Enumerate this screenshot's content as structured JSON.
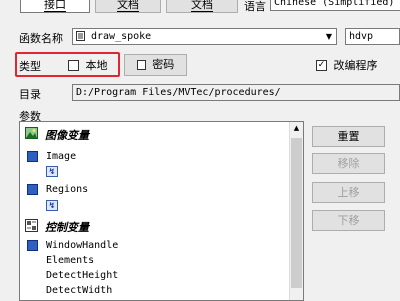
{
  "top_buttons": {
    "interface": "接口",
    "doc1": "文档",
    "doc2": "文档"
  },
  "language": {
    "label": "语言",
    "value": "Chinese (Simplified)"
  },
  "procedure": {
    "label": "函数名称",
    "name": "draw_spoke",
    "extension": "hdvp"
  },
  "type": {
    "label": "类型",
    "local_label": "本地",
    "local_checked": false
  },
  "password_button": "密码",
  "modify": {
    "label": "改编程序",
    "checked": true
  },
  "directory": {
    "label": "目录",
    "path": "D:/Program Files/MVTec/procedures/"
  },
  "params_label": "参数",
  "param_groups": {
    "iconic": {
      "title": "图像变量",
      "items": [
        "Image",
        "Regions"
      ]
    },
    "control": {
      "title": "控制变量",
      "items": [
        "WindowHandle",
        "Elements",
        "DetectHeight",
        "DetectWidth"
      ]
    }
  },
  "side_buttons": {
    "reset": "重置",
    "remove": "移除",
    "up": "上移",
    "down": "下移"
  },
  "colors": {
    "highlight": "#e0262e",
    "icon_blue": "#2f5fbf"
  }
}
